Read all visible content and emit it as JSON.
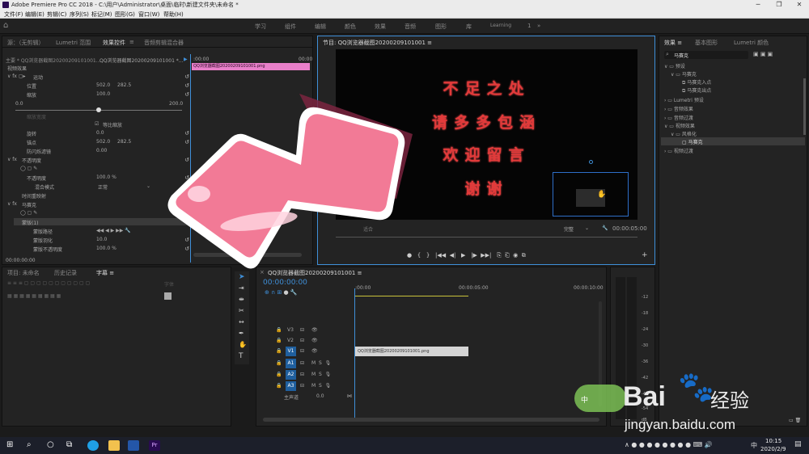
{
  "window": {
    "title": "Adobe Premiere Pro CC 2018 - C:\\用户\\Administrator\\桌面\\临时\\新建文件夹\\未命名 *"
  },
  "menu": [
    "文件(F)",
    "编辑(E)",
    "剪辑(C)",
    "序列(S)",
    "标记(M)",
    "图形(G)",
    "窗口(W)",
    "帮助(H)"
  ],
  "workspaces": [
    "学习",
    "组件",
    "编辑",
    "颜色",
    "效果",
    "音频",
    "图形",
    "库",
    "Learning"
  ],
  "workspace_counter": "1",
  "source_panel": {
    "tabs": [
      "源：（无剪辑）",
      "Lumetri 范围",
      "效果控件",
      "音频剪辑混合器"
    ],
    "master_label": "主要 * QQ浏览器截图20200209101001...",
    "clip_label": "QQ浏览器截图20200209101001 *...",
    "ruler_start": ":00:00",
    "ruler_end": "00:00",
    "clip_bar": "QQ浏览器截图20200209101001.png",
    "video_effects": "视频效果",
    "motion": "运动",
    "position_label": "位置",
    "position_x": "502.0",
    "position_y": "282.5",
    "scale_label": "缩放",
    "scale_value": "100.0",
    "scale_min": "0.0",
    "scale_max": "200.0",
    "scale_width_label": "缩放宽度",
    "uniform_scale": "等比缩放",
    "rotation_label": "旋转",
    "rotation_value": "0.0",
    "anchor_label": "锚点",
    "anchor_x": "502.0",
    "anchor_y": "282.5",
    "flicker_label": "防闪烁滤镜",
    "flicker_value": "0.00",
    "opacity": "不透明度",
    "opacity_label": "不透明度",
    "opacity_value": "100.0 %",
    "blend_label": "混合模式",
    "blend_value": "正常",
    "time_remap": "时间重映射",
    "mosaic": "马赛克",
    "mask": "蒙版(1)",
    "mask_path": "蒙版路径",
    "mask_feather": "蒙版羽化",
    "mask_feather_value": "10.0",
    "mask_opacity": "蒙版不透明度",
    "mask_opacity_value": "100.0 %",
    "timecode": "00:00:00:00"
  },
  "program_panel": {
    "title": "节目: QQ浏览器截图20200209101001 ≡",
    "lines": [
      "不足之处",
      "请多多包涵",
      "欢迎留言",
      "谢谢"
    ],
    "quality": "完整",
    "timecode": "00:00:05:00",
    "fit_label": "适合"
  },
  "effects_panel": {
    "tabs": [
      "效果 ≡",
      "基本图形",
      "Lumetri 颜色"
    ],
    "search_value": "马赛克",
    "tree": [
      "预设",
      "马赛克",
      "马赛克入点",
      "马赛克出点",
      "Lumetri 预设",
      "音频效果",
      "音频过渡",
      "视频效果",
      "风格化",
      "马赛克",
      "视频过渡"
    ]
  },
  "project_panel": {
    "tabs": [
      "项目: 未命名",
      "历史记录",
      "字幕 ≡"
    ],
    "font_label": "字体"
  },
  "timeline": {
    "title": "QQ浏览器截图20200209101001 ≡",
    "timecode": "00:00:00:00",
    "ruler": [
      ":00:00",
      "00:00:05:00",
      "00:00:10:00"
    ],
    "video_tracks": [
      "V3",
      "V2",
      "V1"
    ],
    "audio_tracks": [
      "A1",
      "A2",
      "A3"
    ],
    "master_label": "主声道",
    "master_value": "0.0",
    "clip_name": "QQ浏览器截图20200209101001.png"
  },
  "meter_scale": [
    "-12",
    "-18",
    "-24",
    "-30",
    "-36",
    "-42",
    "-48",
    "-54",
    "dB"
  ],
  "watermark": {
    "brand": "Bai",
    "brand2": "经验",
    "url": "jingyan.baidu.com"
  },
  "taskbar": {
    "time": "10:15",
    "date": "2020/2/9",
    "ime": "中",
    "app": "Pr"
  },
  "colors": {
    "accent": "#3f8fd8",
    "clip_pink": "#e87fc9",
    "arrow_pink": "#f07090",
    "title_red": "#e23a3a"
  }
}
